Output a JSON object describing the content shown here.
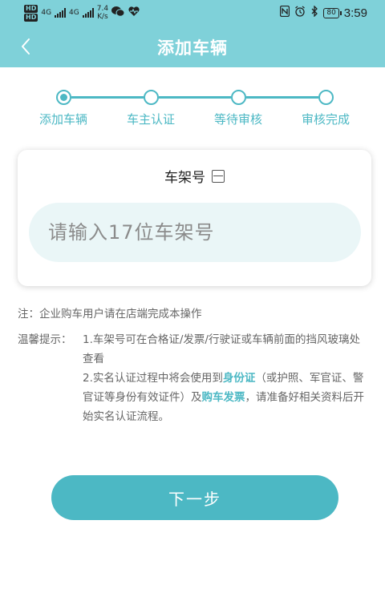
{
  "status_bar": {
    "hd_top": "HD",
    "hd_bottom": "HD",
    "network_1": "4G",
    "network_2": "4G",
    "net_speed_value": "7.4",
    "net_speed_unit": "K/s",
    "battery": "80",
    "time": "3:59",
    "icons": [
      "hd-icon",
      "signal-icon",
      "wechat-icon",
      "heart-pulse-icon",
      "nfc-icon",
      "alarm-icon",
      "bluetooth-icon",
      "battery-icon"
    ]
  },
  "header": {
    "title": "添加车辆",
    "back_icon": "chevron-left-icon"
  },
  "stepper": {
    "steps": [
      {
        "label": "添加车辆",
        "active": true
      },
      {
        "label": "车主认证",
        "active": false
      },
      {
        "label": "等待审核",
        "active": false
      },
      {
        "label": "审核完成",
        "active": false
      }
    ],
    "accent_color": "#4cb8c4"
  },
  "form": {
    "label": "车架号",
    "label_icon": "scan-icon",
    "vin_value": "",
    "vin_placeholder": "请输入17位车架号"
  },
  "notes": {
    "corporate_note": "注：企业购车用户请在店端完成本操作",
    "tips_label": "温馨提示：",
    "tip1": "1.车架号可在合格证/发票/行驶证或车辆前面的挡风玻璃处查看",
    "tip2_part1": "2.实名认证过程中将会使用到",
    "tip2_highlight1": "身份证",
    "tip2_part2": "（或护照、军官证、警官证等身份有效证件）及",
    "tip2_highlight2": "购车发票",
    "tip2_part3": "，请准备好相关资料后开始实名认证流程。"
  },
  "actions": {
    "next_label": "下一步"
  },
  "colors": {
    "header_bg": "#7fd1d9",
    "accent": "#4cb8c4",
    "input_bg": "#eaf6f7"
  }
}
